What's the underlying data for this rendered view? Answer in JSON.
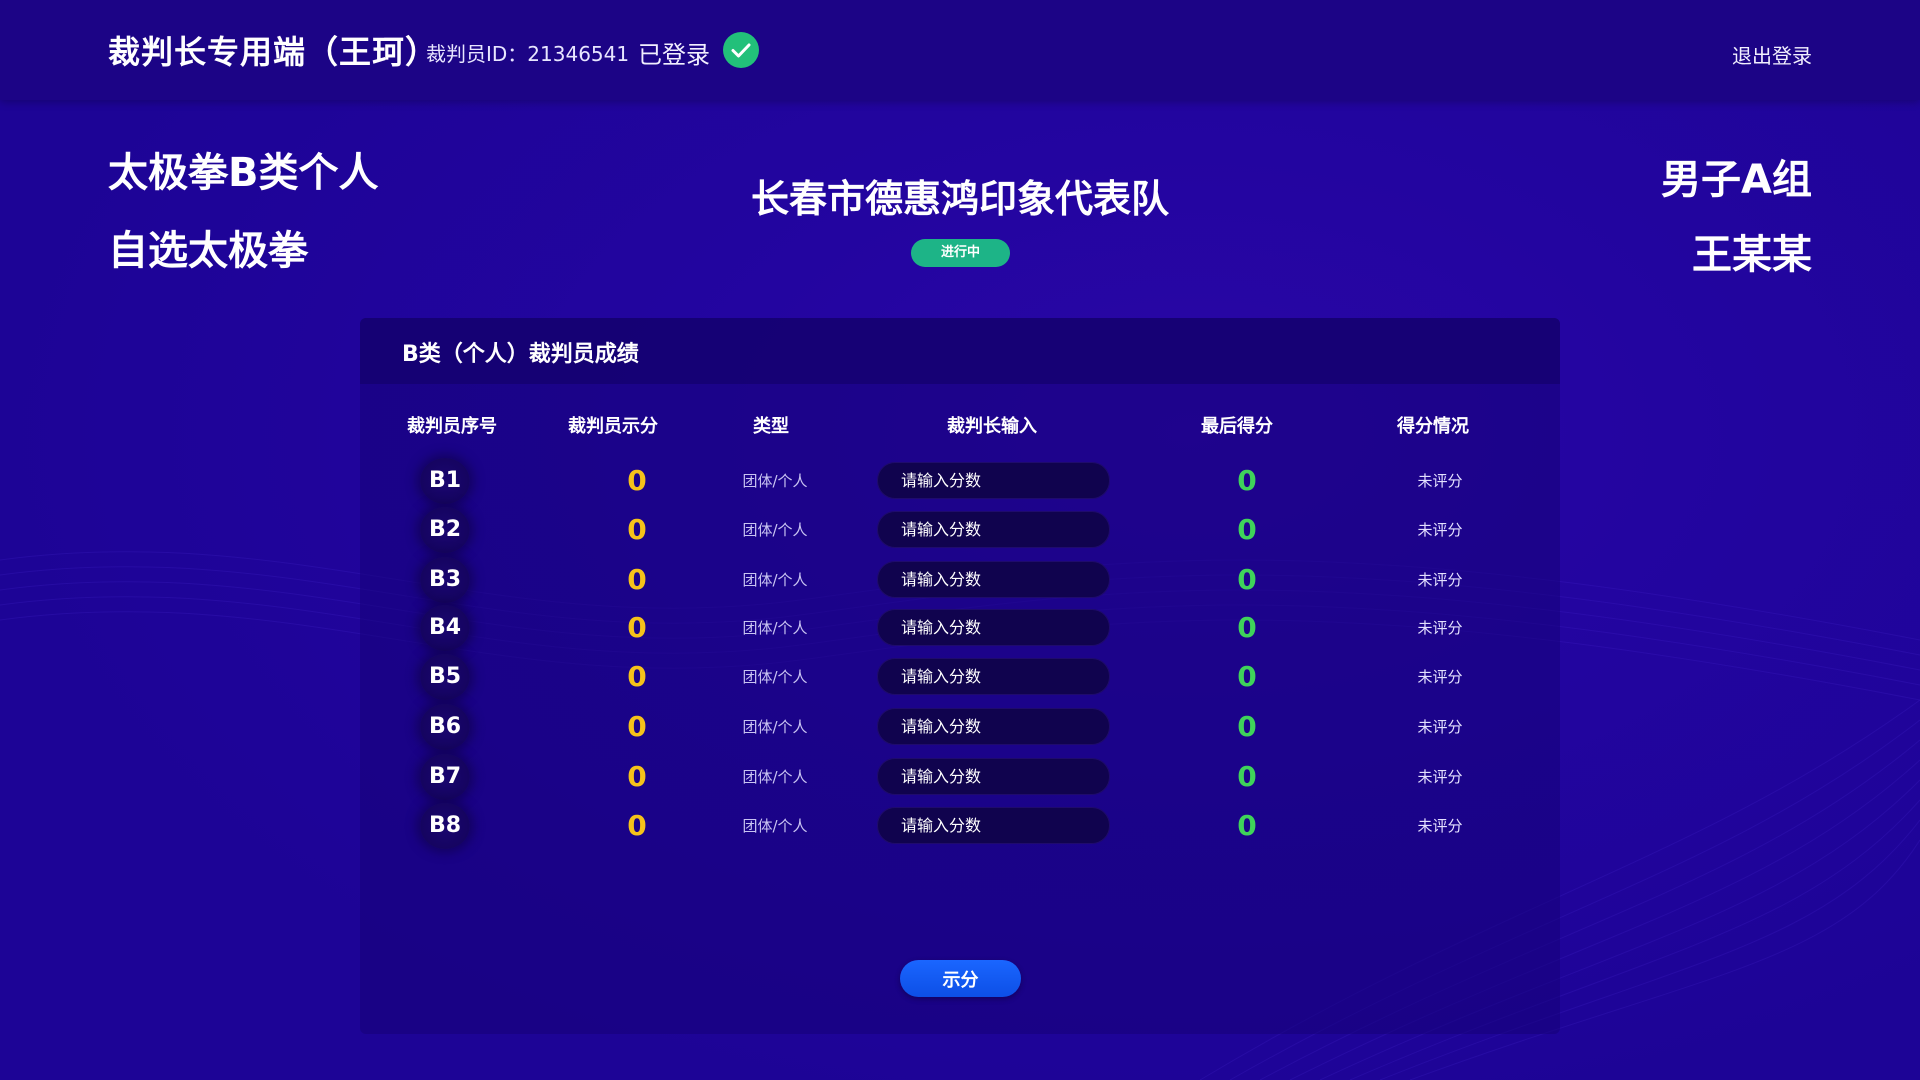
{
  "header": {
    "title": "裁判长专用端（王珂）",
    "judge_id": "裁判员ID：21346541",
    "status": "已登录",
    "logout_label": "退出登录"
  },
  "event": {
    "title": "太极拳B类个人",
    "subtitle": "自选太极拳",
    "team": "长春市德惠鸿印象代表队",
    "status": "进行中",
    "group": "男子A组",
    "athlete": "王某某"
  },
  "panel": {
    "title": "B类（个人）裁判员成绩",
    "columns": [
      "裁判员序号",
      "裁判员示分",
      "类型",
      "裁判长输入",
      "最后得分",
      "得分情况"
    ],
    "rows": [
      {
        "seq": "B1",
        "judge_score": "0",
        "type": "团体/个人",
        "input_placeholder": "请输入分数",
        "final_score": "0",
        "status": "未评分"
      },
      {
        "seq": "B2",
        "judge_score": "0",
        "type": "团体/个人",
        "input_placeholder": "请输入分数",
        "final_score": "0",
        "status": "未评分"
      },
      {
        "seq": "B3",
        "judge_score": "0",
        "type": "团体/个人",
        "input_placeholder": "请输入分数",
        "final_score": "0",
        "status": "未评分"
      },
      {
        "seq": "B4",
        "judge_score": "0",
        "type": "团体/个人",
        "input_placeholder": "请输入分数",
        "final_score": "0",
        "status": "未评分"
      },
      {
        "seq": "B5",
        "judge_score": "0",
        "type": "团体/个人",
        "input_placeholder": "请输入分数",
        "final_score": "0",
        "status": "未评分"
      },
      {
        "seq": "B6",
        "judge_score": "0",
        "type": "团体/个人",
        "input_placeholder": "请输入分数",
        "final_score": "0",
        "status": "未评分"
      },
      {
        "seq": "B7",
        "judge_score": "0",
        "type": "团体/个人",
        "input_placeholder": "请输入分数",
        "final_score": "0",
        "status": "未评分"
      },
      {
        "seq": "B8",
        "judge_score": "0",
        "type": "团体/个人",
        "input_placeholder": "请输入分数",
        "final_score": "0",
        "status": "未评分"
      }
    ],
    "show_button_label": "示分"
  },
  "colors": {
    "background": "#2305a0",
    "header_bg": "#1c0486",
    "judge_score": "#f6c21a",
    "final_score": "#3fd35a",
    "status_pill": "#1db487",
    "button": "#1a66ff"
  },
  "icons": {
    "logged_in": "check-circle-icon"
  }
}
